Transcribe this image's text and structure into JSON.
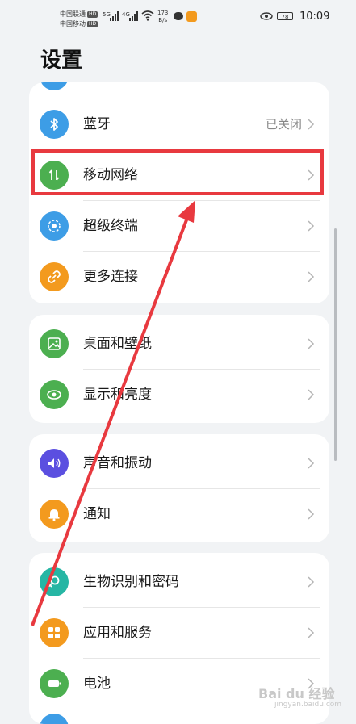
{
  "status_bar": {
    "carrier_1": "中国联通",
    "carrier_2": "中国移动",
    "hd_badge": "HD",
    "net_1": "5G",
    "net_2": "4G",
    "speed_value": "173",
    "speed_unit": "B/s",
    "battery": "78",
    "time": "10:09"
  },
  "page": {
    "title": "设置"
  },
  "groups": [
    {
      "items": [
        {
          "label": "蓝牙",
          "value": "已关闭",
          "icon": "bluetooth-icon",
          "color": "#3d9de6"
        },
        {
          "label": "移动网络",
          "value": "",
          "icon": "mobile-network-icon",
          "color": "#4caf50"
        },
        {
          "label": "超级终端",
          "value": "",
          "icon": "super-device-icon",
          "color": "#3d9de6"
        },
        {
          "label": "更多连接",
          "value": "",
          "icon": "link-icon",
          "color": "#f39a1e"
        }
      ]
    },
    {
      "items": [
        {
          "label": "桌面和壁纸",
          "icon": "wallpaper-icon",
          "color": "#4caf50"
        },
        {
          "label": "显示和亮度",
          "icon": "display-eye-icon",
          "color": "#4caf50"
        }
      ]
    },
    {
      "items": [
        {
          "label": "声音和振动",
          "icon": "sound-icon",
          "color": "#5b4fe0"
        },
        {
          "label": "通知",
          "icon": "bell-icon",
          "color": "#f39a1e"
        }
      ]
    },
    {
      "items": [
        {
          "label": "生物识别和密码",
          "icon": "key-icon",
          "color": "#26b6a4"
        },
        {
          "label": "应用和服务",
          "icon": "apps-icon",
          "color": "#f39a1e"
        },
        {
          "label": "电池",
          "icon": "battery-icon",
          "color": "#4caf50"
        }
      ]
    }
  ],
  "watermark": {
    "text": "Bai du 经验",
    "sub": "jingyan.baidu.com"
  }
}
